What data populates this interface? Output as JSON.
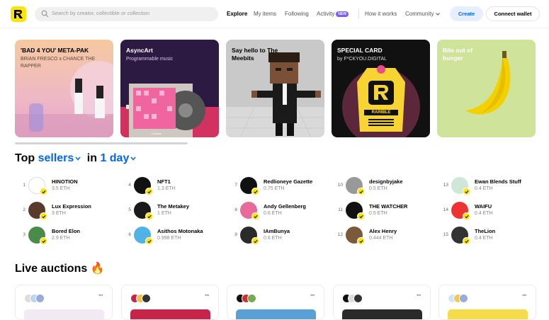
{
  "nav": {
    "search_placeholder": "Search by creator, collectible or collection",
    "links": [
      {
        "label": "Explore",
        "active": true
      },
      {
        "label": "My items"
      },
      {
        "label": "Following"
      },
      {
        "label": "Activity",
        "badge": "NEW"
      },
      {
        "label": "How it works"
      },
      {
        "label": "Community"
      }
    ],
    "create_label": "Create",
    "connect_label": "Connect wallet"
  },
  "featured": [
    {
      "title": "'BAD 4 YOU' META-PAK",
      "subtitle": "BRIAN FRESCO x CHANCE THE RAPPER"
    },
    {
      "title": "AsyncArt",
      "subtitle": "Programmable music",
      "inner_label": "Circular"
    },
    {
      "title": "Say hello to The Meebits",
      "subtitle": ""
    },
    {
      "title": "SPECIAL CARD",
      "subtitle": "by F*CKYOU.DIGITAL",
      "inner_label": "RARIBLE"
    },
    {
      "title": "Bite out of hunger",
      "subtitle": ""
    }
  ],
  "top_sellers": {
    "prefix": "Top",
    "kind": "sellers",
    "mid": "in",
    "period": "1 day",
    "items": [
      {
        "rank": "1",
        "name": "HINOTION",
        "eth": "3.5 ETH"
      },
      {
        "rank": "2",
        "name": "Lux Expression",
        "eth": "3 ETH"
      },
      {
        "rank": "3",
        "name": "Bored Elon",
        "eth": "2.9 ETH"
      },
      {
        "rank": "4",
        "name": "NFT1",
        "eth": "1.3 ETH"
      },
      {
        "rank": "5",
        "name": "The Metakey",
        "eth": "1 ETH"
      },
      {
        "rank": "6",
        "name": "Asithos Motonaka",
        "eth": "0.998 ETH"
      },
      {
        "rank": "7",
        "name": "Redlioneye Gazette",
        "eth": "0.75 ETH"
      },
      {
        "rank": "8",
        "name": "Andy Gellenberg",
        "eth": "0.6 ETH"
      },
      {
        "rank": "9",
        "name": "IAmBunya",
        "eth": "0.6 ETH"
      },
      {
        "rank": "10",
        "name": "designbyjake",
        "eth": "0.5 ETH"
      },
      {
        "rank": "11",
        "name": "THE WATCHER",
        "eth": "0.5 ETH"
      },
      {
        "rank": "12",
        "name": "Alex Henry",
        "eth": "0.444 ETH"
      },
      {
        "rank": "13",
        "name": "Ewan Blends Stuff",
        "eth": "0.4 ETH"
      },
      {
        "rank": "14",
        "name": "WAIFU",
        "eth": "0.4 ETH"
      },
      {
        "rank": "15",
        "name": "TheLion",
        "eth": "0.4 ETH"
      }
    ]
  },
  "live_auctions": {
    "title": "Live auctions",
    "emoji": "🔥",
    "more_label": "···"
  },
  "colors": {
    "accent": "#0066ff",
    "brand_yellow": "#fee400",
    "badge_purple": "#7d5cff"
  }
}
